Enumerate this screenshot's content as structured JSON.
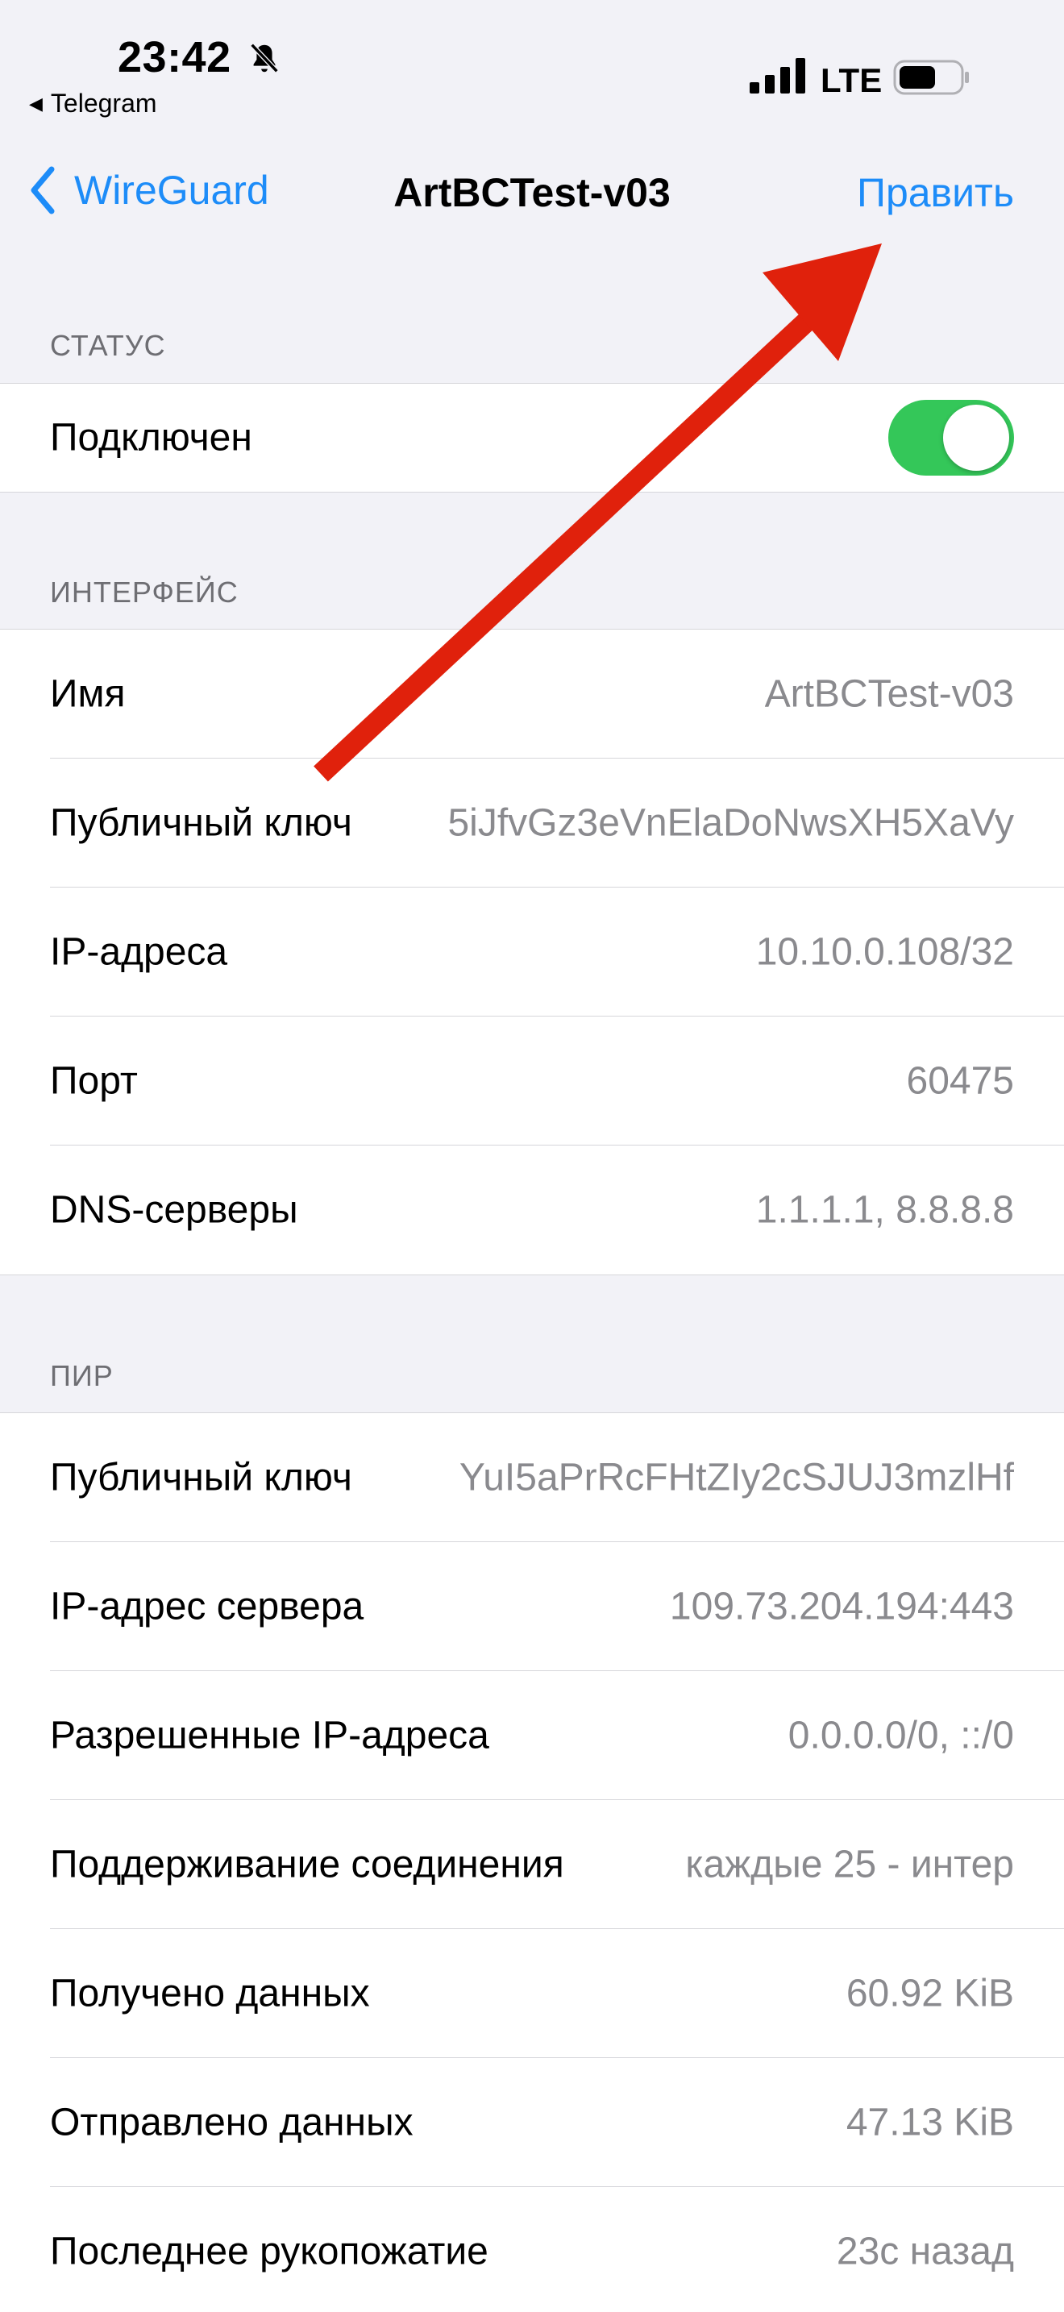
{
  "status_bar": {
    "time": "23:42",
    "back_app": "Telegram",
    "network": "LTE",
    "icons": [
      "bell-slash-icon",
      "signal-icon",
      "battery-icon"
    ]
  },
  "nav": {
    "back_label": "WireGuard",
    "title": "ArtBCTest-v03",
    "edit_label": "Править"
  },
  "status_section": {
    "header": "СТАТУС",
    "connected_label": "Подключен",
    "connected": true
  },
  "interface_section": {
    "header": "ИНТЕРФЕЙС",
    "rows": [
      {
        "label": "Имя",
        "value": "ArtBCTest-v03"
      },
      {
        "label": "Публичный ключ",
        "value": "5iJfvGz3eVnElaDoNwsXH5XaVy"
      },
      {
        "label": "IP-адреса",
        "value": "10.10.0.108/32"
      },
      {
        "label": "Порт",
        "value": "60475"
      },
      {
        "label": "DNS-серверы",
        "value": "1.1.1.1, 8.8.8.8"
      }
    ]
  },
  "peer_section": {
    "header": "ПИР",
    "rows": [
      {
        "label": "Публичный ключ",
        "value": "YuI5aPrRcFHtZIy2cSJUJ3mzlHf"
      },
      {
        "label": "IP-адрес сервера",
        "value": "109.73.204.194:443"
      },
      {
        "label": "Разрешенные IP-адреса",
        "value": "0.0.0.0/0, ::/0"
      },
      {
        "label": "Поддерживание соединения",
        "value": "каждые 25 - интер"
      },
      {
        "label": "Получено данных",
        "value": "60.92 KiB"
      },
      {
        "label": "Отправлено данных",
        "value": "47.13 KiB"
      },
      {
        "label": "Последнее рукопожатие",
        "value": "23с назад"
      }
    ]
  },
  "colors": {
    "accent": "#1d8cf8",
    "toggle_on": "#34c759",
    "annotation_arrow": "#e0210c",
    "background": "#f2f2f7"
  }
}
